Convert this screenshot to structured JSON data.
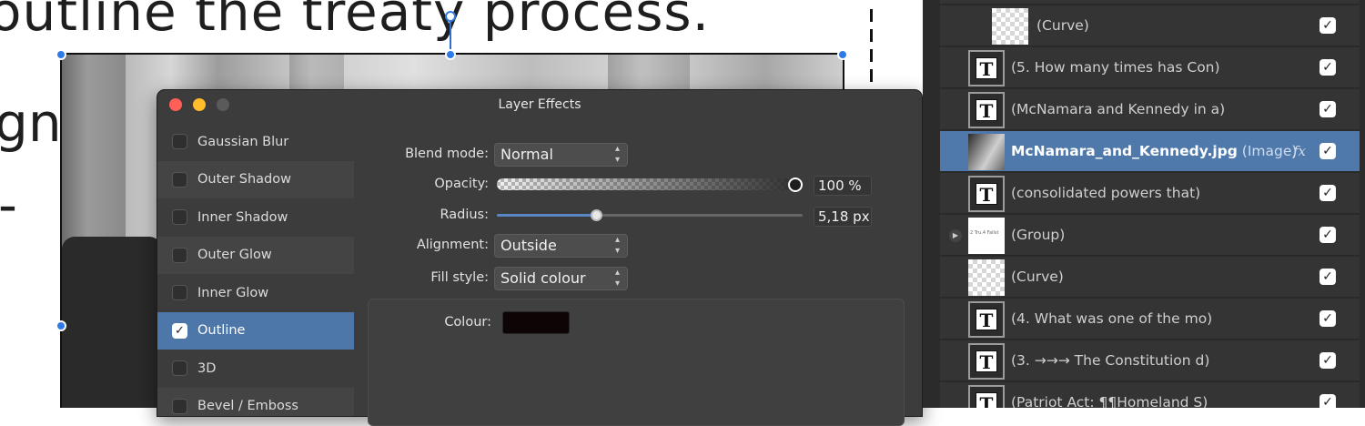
{
  "canvas": {
    "line1": "outline the treaty process.",
    "line2": "gn",
    "line3": "-"
  },
  "dialog": {
    "title": "Layer Effects",
    "effects": [
      {
        "label": "Gaussian Blur",
        "checked": false
      },
      {
        "label": "Outer Shadow",
        "checked": false
      },
      {
        "label": "Inner Shadow",
        "checked": false
      },
      {
        "label": "Outer Glow",
        "checked": false
      },
      {
        "label": "Inner Glow",
        "checked": false
      },
      {
        "label": "Outline",
        "checked": true
      },
      {
        "label": "3D",
        "checked": false
      },
      {
        "label": "Bevel / Emboss",
        "checked": false
      }
    ],
    "check_mark": "✓",
    "blend_mode_label": "Blend mode:",
    "blend_mode_value": "Normal",
    "opacity_label": "Opacity:",
    "opacity_value": "100 %",
    "radius_label": "Radius:",
    "radius_value": "5,18 px",
    "alignment_label": "Alignment:",
    "alignment_value": "Outside",
    "fill_style_label": "Fill style:",
    "fill_style_value": "Solid colour",
    "colour_label": "Colour:",
    "colour_value": "#0d0505",
    "dropdown_arrows": "⌃⌄"
  },
  "layers": {
    "rows": [
      {
        "name": "(Curve)",
        "thumb": "checker",
        "visible": true
      },
      {
        "name": "(5. How many times has Con)",
        "thumb": "text",
        "visible": true
      },
      {
        "name": "(McNamara and Kennedy in a)",
        "thumb": "text",
        "visible": true
      },
      {
        "name": "McNamara_and_Kennedy.jpg",
        "kind": "(Image)",
        "thumb": "photo",
        "visible": true,
        "selected": true,
        "fx": "fx"
      },
      {
        "name": "(consolidated powers that)",
        "thumb": "text",
        "visible": true
      },
      {
        "name": "(Group)",
        "thumb": "group",
        "group_thumb_text": "2 Tru.4 Fallst",
        "visible": true,
        "expandable": true
      },
      {
        "name": "(Curve)",
        "thumb": "checker",
        "visible": true
      },
      {
        "name": "(4. What was one of the mo)",
        "thumb": "text",
        "visible": true
      },
      {
        "name": "(3. →→→ The Constitution d)",
        "thumb": "text",
        "visible": true
      },
      {
        "name": "(Patriot Act: ¶¶Homeland S)",
        "thumb": "text",
        "visible": true
      }
    ],
    "text_thumb_glyph": "T",
    "expand_glyph": "▶",
    "check_mark": "✓"
  }
}
